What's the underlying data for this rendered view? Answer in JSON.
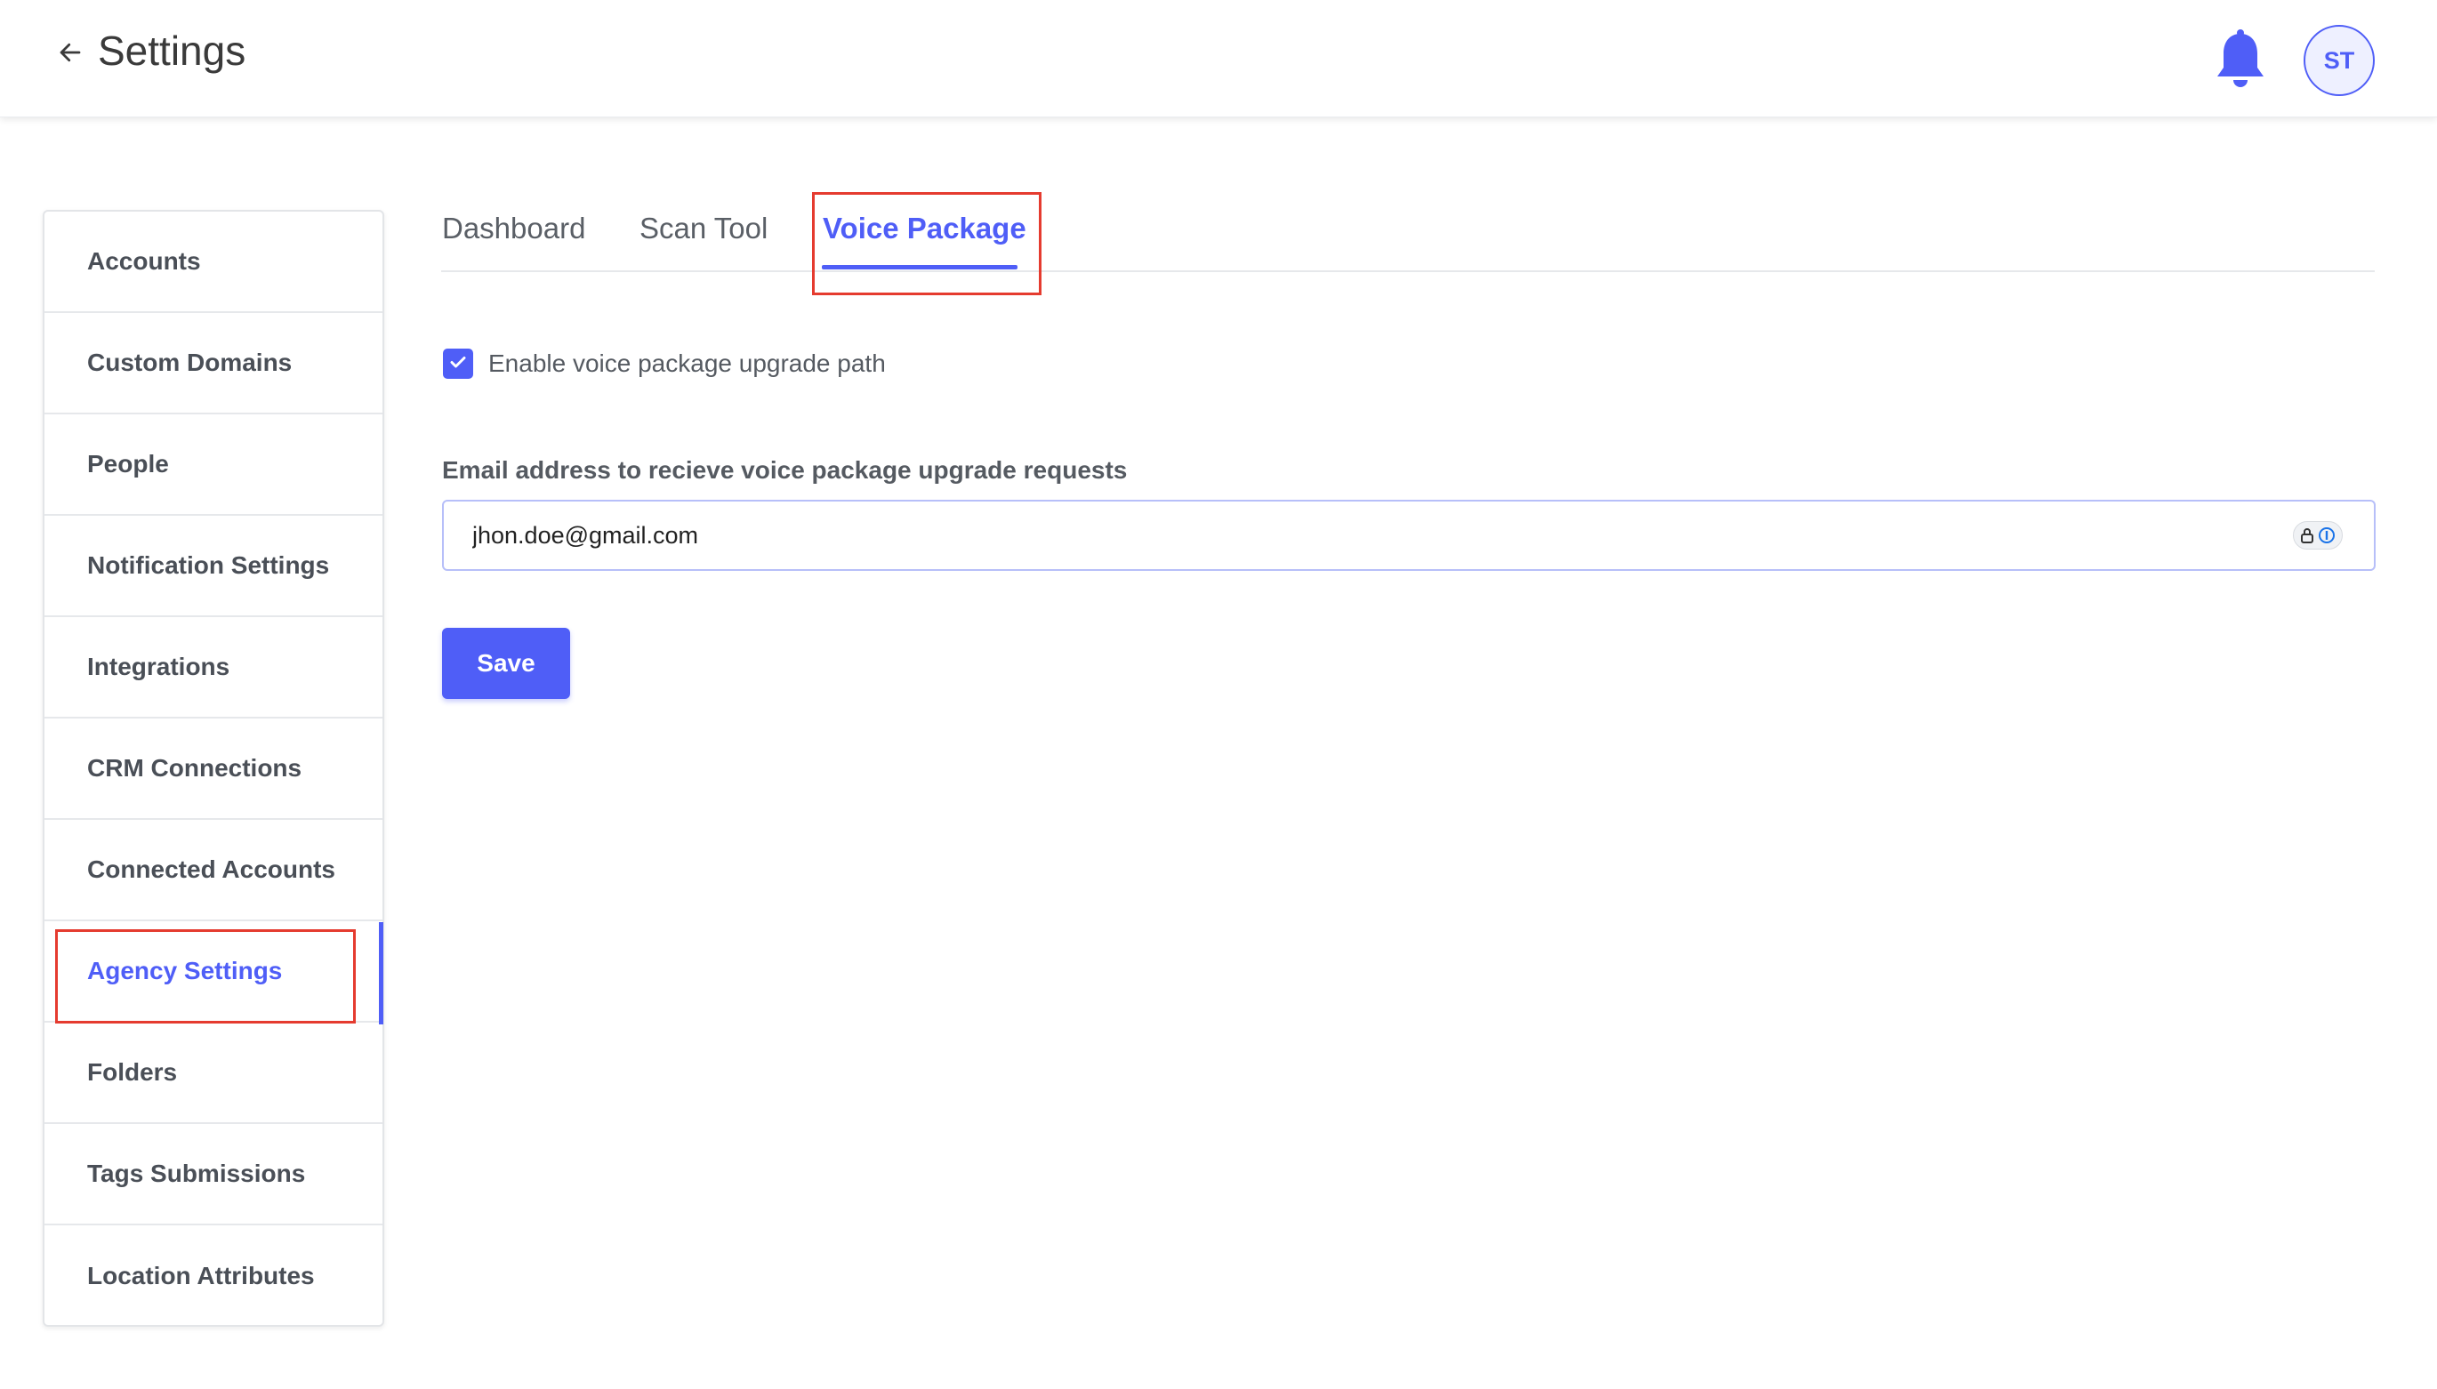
{
  "header": {
    "title": "Settings",
    "back_icon": "arrow-left-icon",
    "notification_icon": "bell-icon",
    "avatar_initials": "ST"
  },
  "sidebar": {
    "items": [
      {
        "label": "Accounts"
      },
      {
        "label": "Custom Domains"
      },
      {
        "label": "People"
      },
      {
        "label": "Notification Settings"
      },
      {
        "label": "Integrations"
      },
      {
        "label": "CRM Connections"
      },
      {
        "label": "Connected Accounts"
      },
      {
        "label": "Agency Settings",
        "active": true
      },
      {
        "label": "Folders"
      },
      {
        "label": "Tags Submissions"
      },
      {
        "label": "Location Attributes"
      }
    ]
  },
  "tabs": [
    {
      "label": "Dashboard"
    },
    {
      "label": "Scan Tool"
    },
    {
      "label": "Voice Package",
      "active": true
    }
  ],
  "form": {
    "enable_checkbox_label": "Enable voice package upgrade path",
    "enable_checked": true,
    "email_label": "Email address to recieve voice package upgrade requests",
    "email_value": "jhon.doe@gmail.com",
    "save_label": "Save"
  },
  "colors": {
    "accent": "#4f5ef7",
    "highlight": "#e53b2f",
    "text": "#4a4f57"
  }
}
